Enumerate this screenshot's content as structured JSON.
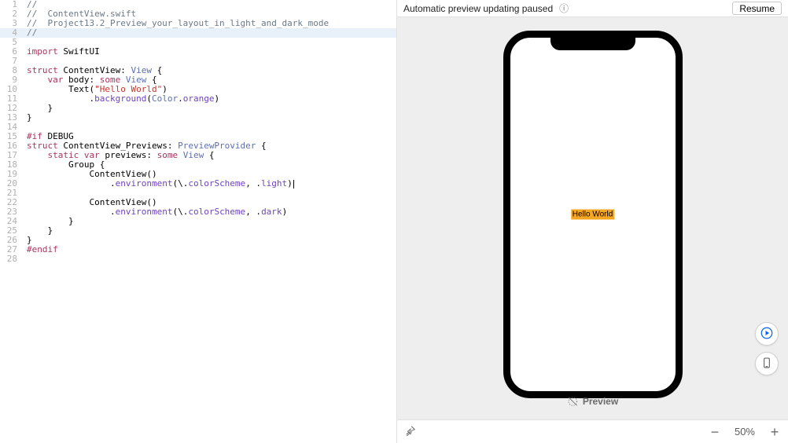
{
  "editor": {
    "lines": [
      {
        "n": 1,
        "hl": false,
        "seg": [
          [
            "//",
            "comment"
          ]
        ]
      },
      {
        "n": 2,
        "hl": false,
        "seg": [
          [
            "//  ContentView.swift",
            "comment"
          ]
        ]
      },
      {
        "n": 3,
        "hl": false,
        "seg": [
          [
            "//  Project13.2_Preview_your_layout_in_light_and_dark_mode",
            "comment"
          ]
        ]
      },
      {
        "n": 4,
        "hl": true,
        "seg": [
          [
            "//",
            "comment"
          ]
        ]
      },
      {
        "n": 5,
        "hl": false,
        "seg": [
          [
            "",
            "plain"
          ]
        ]
      },
      {
        "n": 6,
        "hl": false,
        "seg": [
          [
            "import",
            "keyword"
          ],
          [
            " SwiftUI",
            "plain"
          ]
        ]
      },
      {
        "n": 7,
        "hl": false,
        "seg": [
          [
            "",
            "plain"
          ]
        ]
      },
      {
        "n": 8,
        "hl": false,
        "seg": [
          [
            "struct",
            "keyword"
          ],
          [
            " ContentView: ",
            "plain"
          ],
          [
            "View",
            "type"
          ],
          [
            " {",
            "plain"
          ]
        ]
      },
      {
        "n": 9,
        "hl": false,
        "seg": [
          [
            "    ",
            "plain"
          ],
          [
            "var",
            "keyword"
          ],
          [
            " body: ",
            "plain"
          ],
          [
            "some",
            "keyword"
          ],
          [
            " ",
            "plain"
          ],
          [
            "View",
            "type"
          ],
          [
            " {",
            "plain"
          ]
        ]
      },
      {
        "n": 10,
        "hl": false,
        "seg": [
          [
            "        Text(",
            "plain"
          ],
          [
            "\"Hello World\"",
            "string"
          ],
          [
            ")",
            "plain"
          ]
        ]
      },
      {
        "n": 11,
        "hl": false,
        "seg": [
          [
            "            .",
            "plain"
          ],
          [
            "background",
            "member"
          ],
          [
            "(",
            "plain"
          ],
          [
            "Color",
            "type"
          ],
          [
            ".",
            "plain"
          ],
          [
            "orange",
            "member"
          ],
          [
            ")",
            "plain"
          ]
        ]
      },
      {
        "n": 12,
        "hl": false,
        "seg": [
          [
            "    }",
            "plain"
          ]
        ]
      },
      {
        "n": 13,
        "hl": false,
        "seg": [
          [
            "}",
            "plain"
          ]
        ]
      },
      {
        "n": 14,
        "hl": false,
        "seg": [
          [
            "",
            "plain"
          ]
        ]
      },
      {
        "n": 15,
        "hl": false,
        "seg": [
          [
            "#if",
            "keyword"
          ],
          [
            " DEBUG",
            "plain"
          ]
        ]
      },
      {
        "n": 16,
        "hl": false,
        "seg": [
          [
            "struct",
            "keyword"
          ],
          [
            " ContentView_Previews: ",
            "plain"
          ],
          [
            "PreviewProvider",
            "type"
          ],
          [
            " {",
            "plain"
          ]
        ]
      },
      {
        "n": 17,
        "hl": false,
        "seg": [
          [
            "    ",
            "plain"
          ],
          [
            "static",
            "keyword"
          ],
          [
            " ",
            "plain"
          ],
          [
            "var",
            "keyword"
          ],
          [
            " previews: ",
            "plain"
          ],
          [
            "some",
            "keyword"
          ],
          [
            " ",
            "plain"
          ],
          [
            "View",
            "type"
          ],
          [
            " {",
            "plain"
          ]
        ]
      },
      {
        "n": 18,
        "hl": false,
        "seg": [
          [
            "        Group {",
            "plain"
          ]
        ]
      },
      {
        "n": 19,
        "hl": false,
        "seg": [
          [
            "            ContentView()",
            "plain"
          ]
        ]
      },
      {
        "n": 20,
        "hl": false,
        "seg": [
          [
            "                .",
            "plain"
          ],
          [
            "environment",
            "member"
          ],
          [
            "(\\.",
            "plain"
          ],
          [
            "colorScheme",
            "member"
          ],
          [
            ", .",
            "plain"
          ],
          [
            "light",
            "member"
          ],
          [
            ")",
            "plain"
          ]
        ],
        "caret": true
      },
      {
        "n": 21,
        "hl": false,
        "seg": [
          [
            "",
            "plain"
          ]
        ]
      },
      {
        "n": 22,
        "hl": false,
        "seg": [
          [
            "            ContentView()",
            "plain"
          ]
        ]
      },
      {
        "n": 23,
        "hl": false,
        "seg": [
          [
            "                .",
            "plain"
          ],
          [
            "environment",
            "member"
          ],
          [
            "(\\.",
            "plain"
          ],
          [
            "colorScheme",
            "member"
          ],
          [
            ", .",
            "plain"
          ],
          [
            "dark",
            "member"
          ],
          [
            ")",
            "plain"
          ]
        ]
      },
      {
        "n": 24,
        "hl": false,
        "seg": [
          [
            "        }",
            "plain"
          ]
        ]
      },
      {
        "n": 25,
        "hl": false,
        "seg": [
          [
            "    }",
            "plain"
          ]
        ]
      },
      {
        "n": 26,
        "hl": false,
        "seg": [
          [
            "}",
            "plain"
          ]
        ]
      },
      {
        "n": 27,
        "hl": false,
        "seg": [
          [
            "#endif",
            "keyword"
          ]
        ]
      },
      {
        "n": 28,
        "hl": false,
        "seg": [
          [
            "",
            "plain"
          ]
        ]
      }
    ]
  },
  "preview": {
    "status_text": "Automatic preview updating paused",
    "info_icon": "ⓘ",
    "resume_label": "Resume",
    "app_text": "Hello World",
    "app_bg_color": "#f5a623",
    "preview_label": "Preview",
    "zoom_level": "50%",
    "pin_icon_name": "pin-icon",
    "play_icon_name": "play-circle-icon",
    "device_icon_name": "device-icon"
  }
}
